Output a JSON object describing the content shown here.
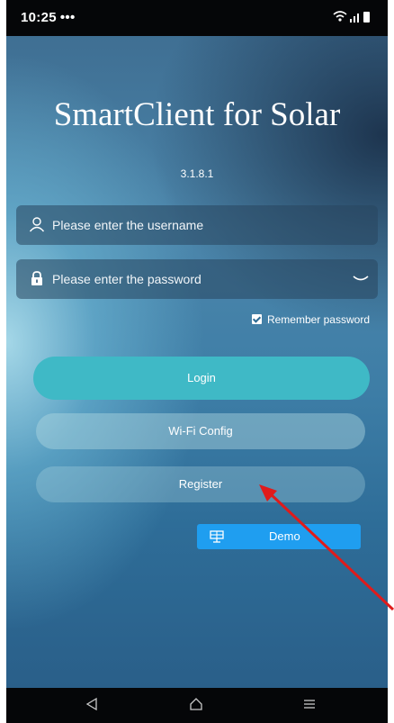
{
  "status_bar": {
    "time": "10:25",
    "more": "•••",
    "signal_text": "ᯤ.ıl"
  },
  "app": {
    "title": "SmartClient for Solar",
    "version": "3.1.8.1"
  },
  "login_form": {
    "username_placeholder": "Please enter the username",
    "password_placeholder": "Please enter the password",
    "remember_label": "Remember password",
    "remember_checked": true
  },
  "buttons": {
    "login": "Login",
    "wifi_config": "Wi-Fi Config",
    "register": "Register",
    "demo": "Demo"
  },
  "icons": {
    "user": "user-icon",
    "lock": "lock-icon",
    "eye": "eye-closed-icon",
    "demo": "solar-panel-icon",
    "back": "back-triangle-icon",
    "home": "home-icon",
    "menu": "menu-icon"
  },
  "annotation": {
    "arrow_color": "#e01b1b"
  },
  "colors": {
    "login_button": "#3fb9c6",
    "demo_button": "#1f9ef0"
  }
}
